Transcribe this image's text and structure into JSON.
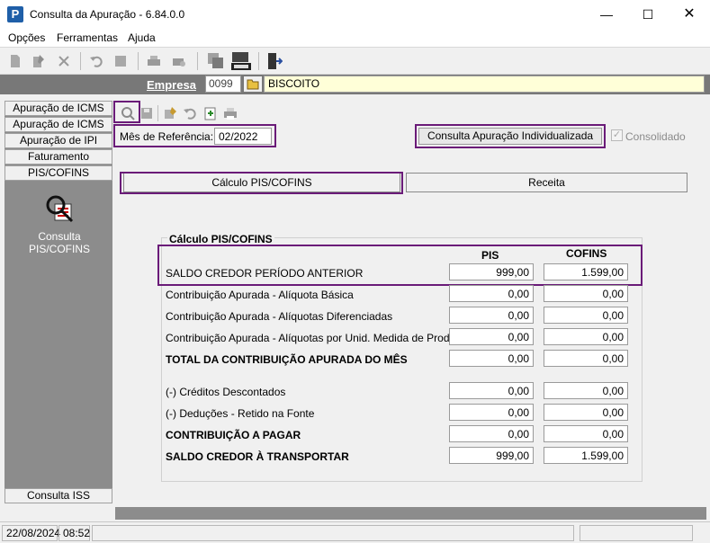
{
  "window": {
    "title": "Consulta da Apuração - 6.84.0.0",
    "app_icon_letter": "P"
  },
  "menu": {
    "items": [
      "Opções",
      "Ferramentas",
      "Ajuda"
    ]
  },
  "toolbar": {
    "icons": [
      "new-icon",
      "edit-icon",
      "delete-icon",
      "undo-icon",
      "stop-icon",
      "print-icon",
      "print-preview-icon",
      "copy-window-icon",
      "sped-file-icon",
      "exit-door-icon"
    ]
  },
  "empresa": {
    "label": "Empresa",
    "code": "0099",
    "name": "BISCOITO"
  },
  "sidebar": {
    "tabs": [
      "Apuração de ICMS",
      "Apuração de ICMS ST",
      "Apuração de IPI",
      "Faturamento",
      "PIS/COFINS"
    ],
    "tool_label_line1": "Consulta",
    "tool_label_line2": "PIS/COFINS",
    "bottom_tab": "Consulta ISS"
  },
  "form": {
    "mes_label": "Mês de Referência:",
    "mes_value": "02/2022",
    "consulta_button": "Consulta Apuração Individualizada",
    "consolidado_label": "Consolidado",
    "tabs": [
      "Cálculo PIS/COFINS",
      "Receita"
    ]
  },
  "calc": {
    "group_title": "Cálculo PIS/COFINS",
    "col_pis": "PIS",
    "col_cofins": "COFINS",
    "rows": [
      {
        "label": "SALDO CREDOR PERÍODO ANTERIOR",
        "pis": "999,00",
        "cofins": "1.599,00"
      },
      {
        "label": "Contribuição Apurada - Alíquota Básica",
        "pis": "0,00",
        "cofins": "0,00"
      },
      {
        "label": "Contribuição Apurada - Alíquotas Diferenciadas",
        "pis": "0,00",
        "cofins": "0,00"
      },
      {
        "label": "Contribuição Apurada - Alíquotas por Unid. Medida de Produto",
        "pis": "0,00",
        "cofins": "0,00"
      },
      {
        "label": "TOTAL DA CONTRIBUIÇÃO APURADA DO MÊS",
        "pis": "0,00",
        "cofins": "0,00"
      },
      {
        "label": "(-) Créditos Descontados",
        "pis": "0,00",
        "cofins": "0,00"
      },
      {
        "label": "(-) Deduções - Retido na Fonte",
        "pis": "0,00",
        "cofins": "0,00"
      },
      {
        "label": "CONTRIBUIÇÃO A PAGAR",
        "pis": "0,00",
        "cofins": "0,00"
      },
      {
        "label": "SALDO CREDOR À TRANSPORTAR",
        "pis": "999,00",
        "cofins": "1.599,00"
      }
    ]
  },
  "status": {
    "date": "22/08/2024",
    "time": "08:52"
  },
  "colors": {
    "highlight": "#6a1b78",
    "empresa_bar": "#787878",
    "sidebar": "#8c8c8c",
    "empresa_name_bg": "#ffffd8"
  }
}
